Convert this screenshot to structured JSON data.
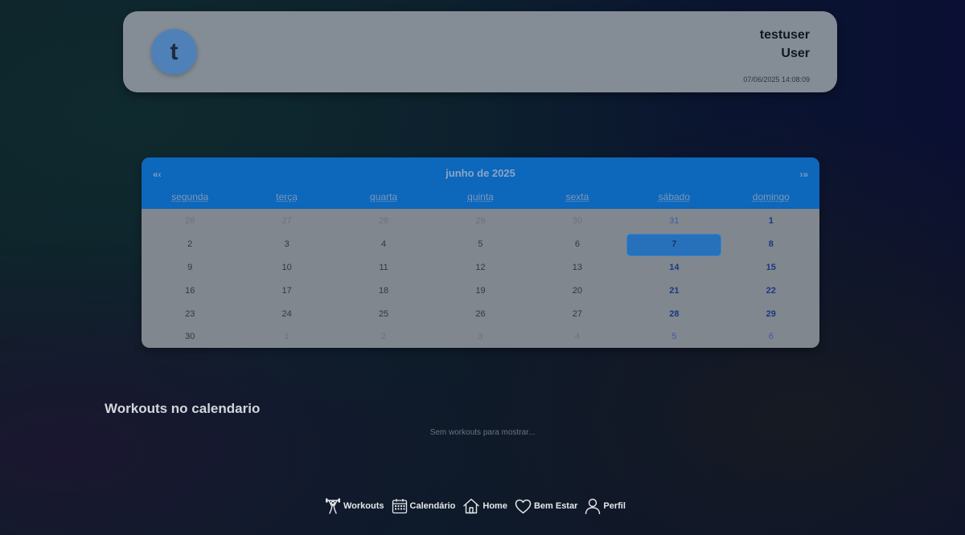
{
  "profile": {
    "avatar_letter": "t",
    "username": "testuser",
    "role": "User",
    "timestamp": "07/06/2025 14:08:09"
  },
  "calendar": {
    "prev_label": "«‹",
    "next_label": "›»",
    "month_title": "junho de 2025",
    "weekdays": [
      "segunda",
      "terça",
      "quarta",
      "quinta",
      "sexta",
      "sábado",
      "domingo"
    ],
    "weeks": [
      [
        "26",
        "27",
        "28",
        "29",
        "30",
        "31",
        "1"
      ],
      [
        "2",
        "3",
        "4",
        "5",
        "6",
        "7",
        "8"
      ],
      [
        "9",
        "10",
        "11",
        "12",
        "13",
        "14",
        "15"
      ],
      [
        "16",
        "17",
        "18",
        "19",
        "20",
        "21",
        "22"
      ],
      [
        "23",
        "24",
        "25",
        "26",
        "27",
        "28",
        "29"
      ],
      [
        "30",
        "1",
        "2",
        "3",
        "4",
        "5",
        "6"
      ]
    ],
    "selected_day": "7"
  },
  "workouts": {
    "title": "Workouts no calendario",
    "empty_message": "Sem workouts para mostrar..."
  },
  "nav": {
    "items": [
      {
        "label": "Workouts",
        "icon": "weightlifter-icon"
      },
      {
        "label": "Calendário",
        "icon": "calendar-icon"
      },
      {
        "label": "Home",
        "icon": "home-icon"
      },
      {
        "label": "Bem Estar",
        "icon": "heart-icon"
      },
      {
        "label": "Perfil",
        "icon": "user-icon"
      }
    ]
  },
  "colors": {
    "header_blue": "#0d67ba",
    "selected_day": "#2771ba",
    "weekend_text": "#163a82"
  }
}
